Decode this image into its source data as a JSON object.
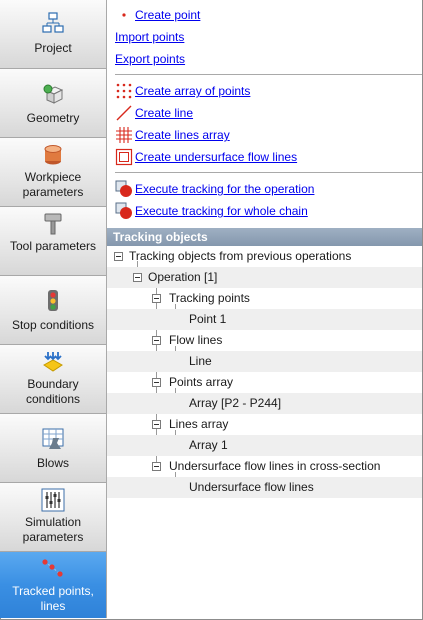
{
  "nav": {
    "items": [
      {
        "label": "Project",
        "icon": "project-icon"
      },
      {
        "label": "Geometry",
        "icon": "geometry-icon"
      },
      {
        "label": "Workpiece parameters",
        "icon": "workpiece-icon"
      },
      {
        "label": "Tool parameters",
        "icon": "tool-icon"
      },
      {
        "label": "Stop conditions",
        "icon": "stop-conditions-icon"
      },
      {
        "label": "Boundary conditions",
        "icon": "boundary-conditions-icon"
      },
      {
        "label": "Blows",
        "icon": "blows-icon"
      },
      {
        "label": "Simulation parameters",
        "icon": "simulation-parameters-icon"
      },
      {
        "label": "Tracked points, lines",
        "icon": "tracked-points-icon"
      }
    ],
    "active": "Tracked points, lines",
    "active_color": "#3a8fe3"
  },
  "actions": {
    "create_point": "Create point",
    "import_points": "Import points",
    "export_points": "Export points",
    "create_array_points": "Create array of points",
    "create_line": "Create line",
    "create_lines_array": "Create lines array",
    "create_undersurface": "Create undersurface flow lines",
    "execute_operation": "Execute tracking for the operation",
    "execute_chain": "Execute tracking for whole chain"
  },
  "section": {
    "title": "Tracking objects"
  },
  "tree": {
    "root": "Tracking objects from previous operations",
    "operation": "Operation [1]",
    "tracking_points": "Tracking points",
    "point_1": "Point 1",
    "flow_lines": "Flow lines",
    "line": "Line",
    "points_array": "Points array",
    "array_p2": "Array [P2 - P244]",
    "lines_array": "Lines array",
    "array_1": "Array 1",
    "undersurface_section": "Undersurface flow lines in cross-section",
    "undersurface": "Undersurface flow lines"
  },
  "colors": {
    "link": "#0000ee",
    "header": "#8a9cb1",
    "red": "#d8281c"
  }
}
